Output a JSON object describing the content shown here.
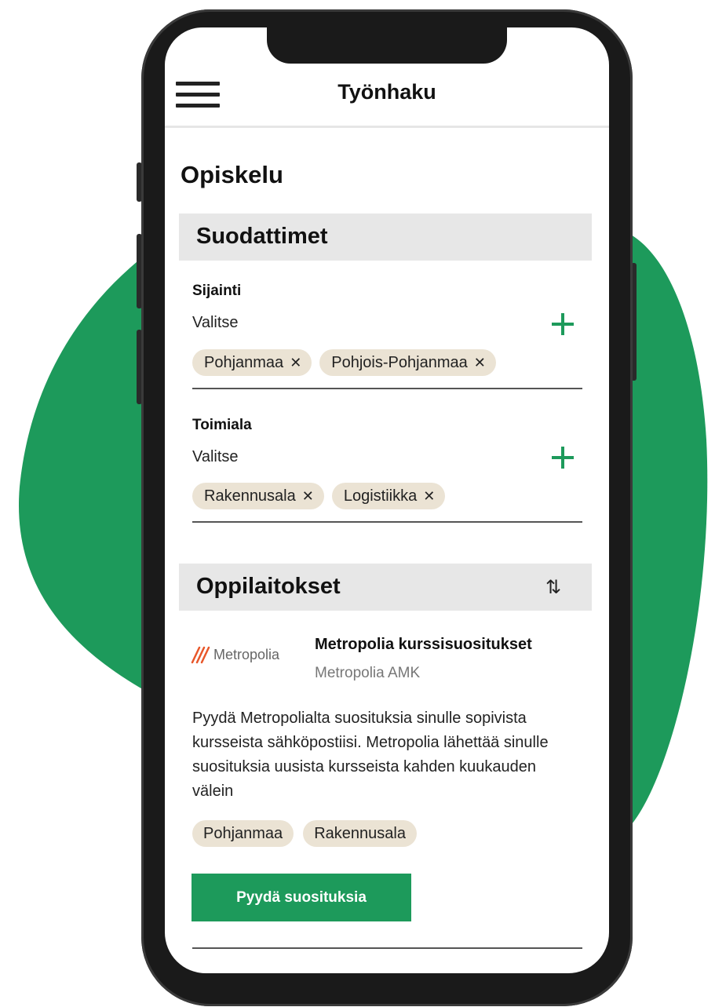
{
  "colors": {
    "accent": "#1d9a5b",
    "chip": "#ebe3d4",
    "section": "#e7e7e7"
  },
  "header": {
    "title": "Työnhaku",
    "menu_icon": "hamburger-menu-icon"
  },
  "page": {
    "title": "Opiskelu"
  },
  "filters": {
    "heading": "Suodattimet",
    "groups": [
      {
        "label": "Sijainti",
        "select": "Valitse",
        "chips": [
          "Pohjanmaa",
          "Pohjois-Pohjanmaa"
        ]
      },
      {
        "label": "Toimiala",
        "select": "Valitse",
        "chips": [
          "Rakennusala",
          "Logistiikka"
        ]
      }
    ],
    "remove_glyph": "✕"
  },
  "institutions": {
    "heading": "Oppilaitokset",
    "sort_glyph": "⇅",
    "card": {
      "logo_text": "Metropolia",
      "title": "Metropolia kurssisuositukset",
      "subtitle": "Metropolia AMK",
      "description": "Pyydä Metropolialta suosituksia sinulle sopivista kursseista sähköpostiisi. Metropolia lähettää sinulle suosituksia uusista kursseista kahden kuukauden välein",
      "tags": [
        "Pohjanmaa",
        "Rakennusala"
      ],
      "cta": "Pyydä suosituksia"
    }
  }
}
